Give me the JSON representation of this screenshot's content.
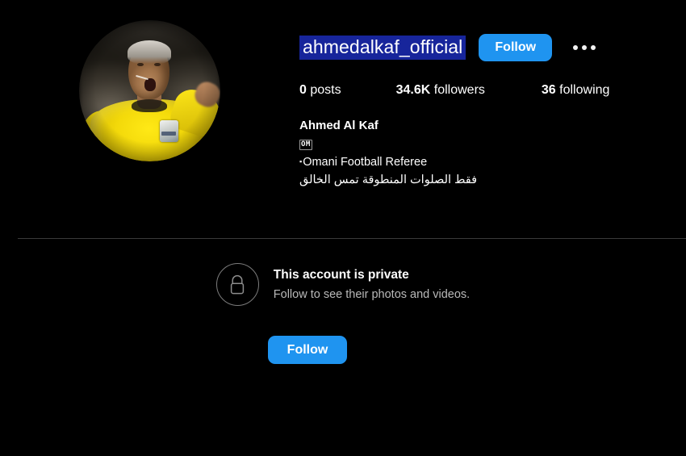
{
  "theme": {
    "background": "#000000",
    "accent_blue": "#1f94f0",
    "selection_blue": "#17259b",
    "divider": "#3a3a3a",
    "secondary_text": "#b9b9b9"
  },
  "profile": {
    "username": "ahmedalkaf_official",
    "follow_label": "Follow",
    "more_options_label": "•••",
    "avatar_alt": "Ahmed Al Kaf referee portrait",
    "stats": {
      "posts_count": "0",
      "posts_label": "posts",
      "followers_count": "34.6K",
      "followers_label": "followers",
      "following_count": "36",
      "following_label": "following"
    },
    "bio": {
      "full_name": "Ahmed Al Kaf",
      "flag_code": "OM",
      "occupation_bullet": "▪",
      "occupation": "Omani Football Referee",
      "arabic_line": "فقط الصلوات المنطوقة تمس الخالق"
    }
  },
  "private_notice": {
    "icon": "lock-icon",
    "title": "This account is private",
    "subtitle": "Follow to see their photos and videos.",
    "follow_label": "Follow"
  }
}
